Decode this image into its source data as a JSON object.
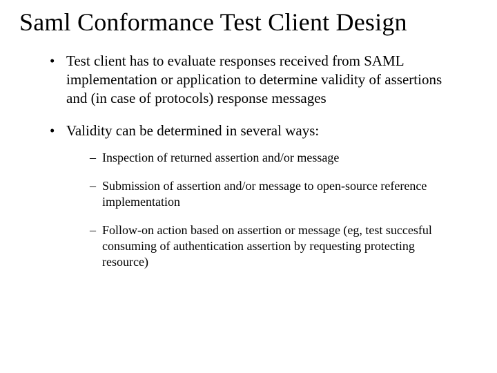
{
  "title": "Saml Conformance Test Client Design",
  "bullets": [
    {
      "text": "Test client has to evaluate responses received from SAML implementation or application to determine validity of assertions and (in case of protocols) response messages"
    },
    {
      "text": "Validity can be determined in several ways:",
      "sub": [
        "Inspection of returned assertion and/or message",
        "Submission of assertion and/or message to open-source reference implementation",
        "Follow-on action based on assertion or message (eg, test succesful consuming of authentication assertion by requesting protecting resource)"
      ]
    }
  ]
}
